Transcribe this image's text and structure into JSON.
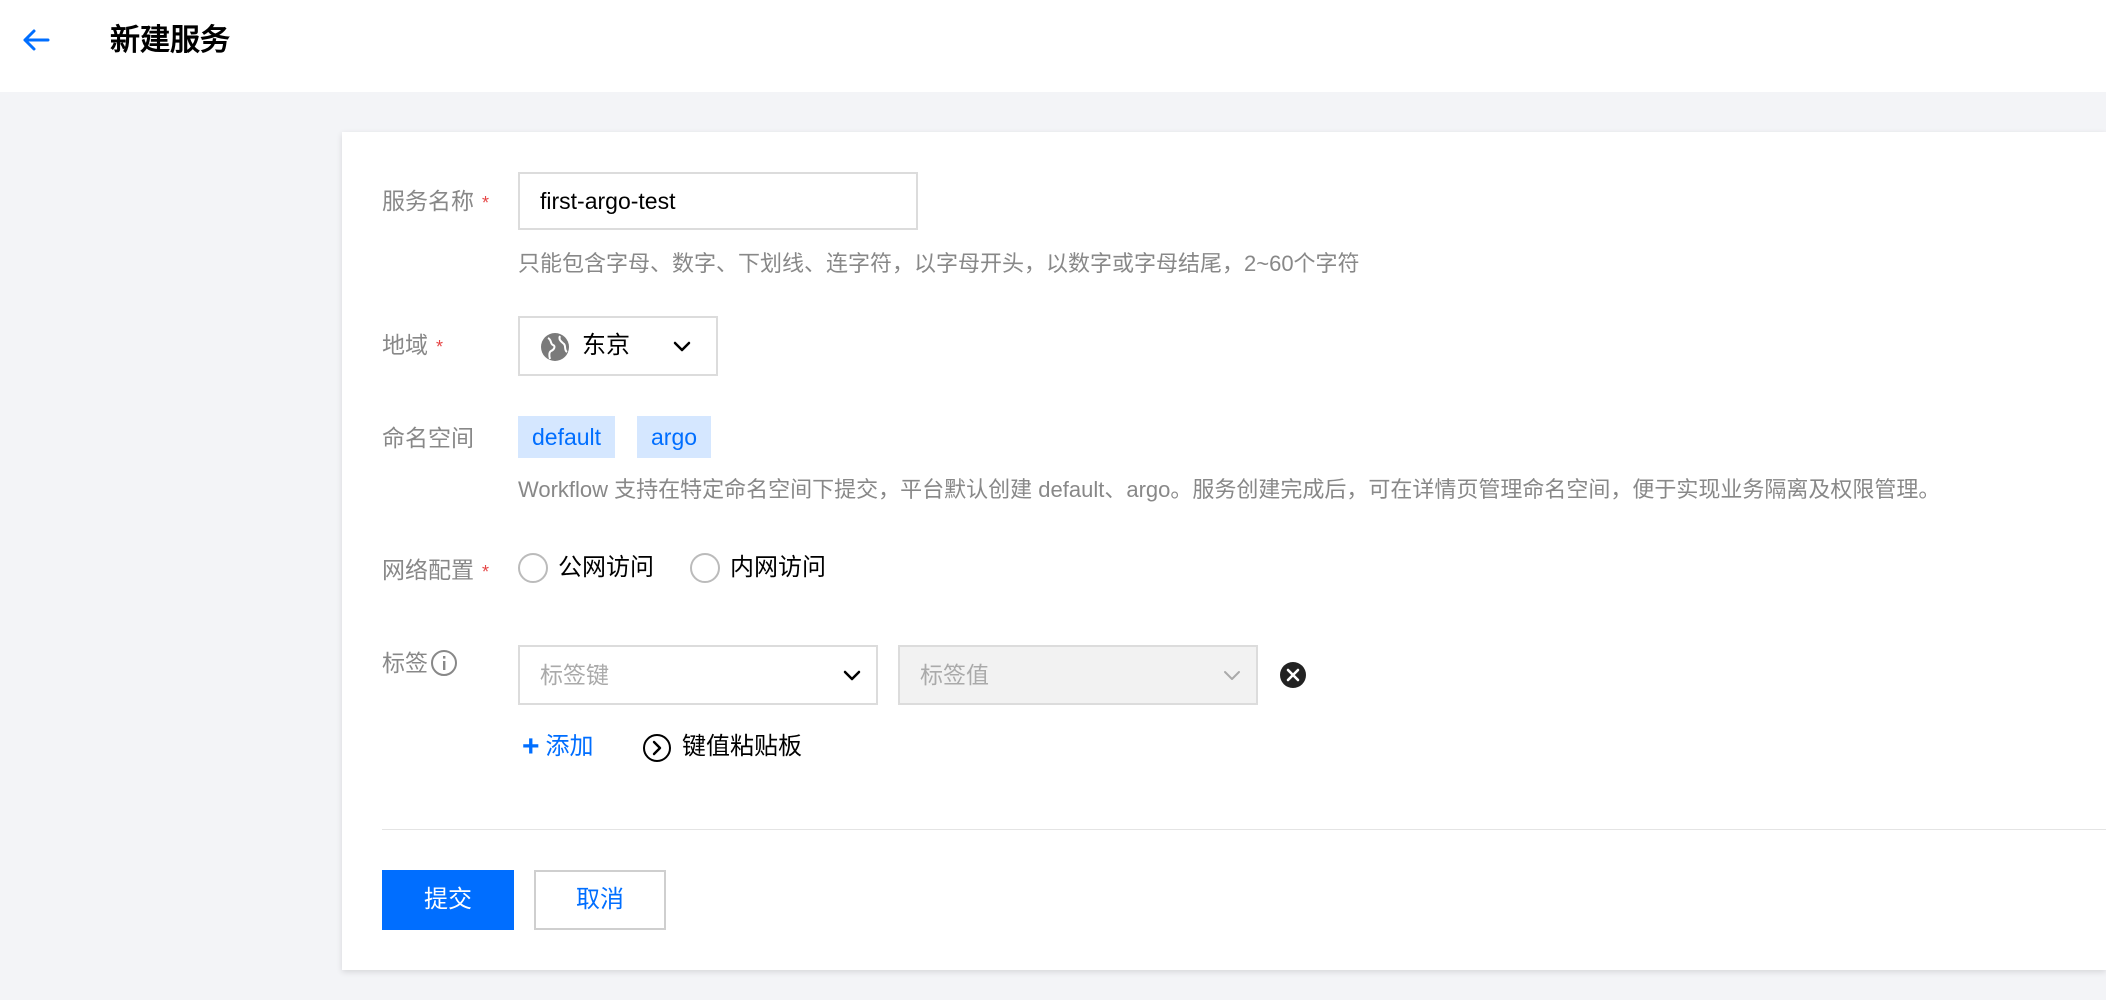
{
  "header": {
    "title": "新建服务"
  },
  "form": {
    "service_name": {
      "label": "服务名称",
      "required_mark": "*",
      "value": "first-argo-test",
      "hint": "只能包含字母、数字、下划线、连字符，以字母开头，以数字或字母结尾，2~60个字符"
    },
    "region": {
      "label": "地域",
      "required_mark": "*",
      "value": "东京",
      "icon": "globe-icon"
    },
    "namespace": {
      "label": "命名空间",
      "tags": [
        "default",
        "argo"
      ],
      "hint": "Workflow 支持在特定命名空间下提交，平台默认创建 default、argo。服务创建完成后，可在详情页管理命名空间，便于实现业务隔离及权限管理。"
    },
    "network": {
      "label": "网络配置",
      "required_mark": "*",
      "options": [
        "公网访问",
        "内网访问"
      ]
    },
    "tags": {
      "label": "标签",
      "key_placeholder": "标签键",
      "value_placeholder": "标签值",
      "add_label": "添加",
      "add_symbol": "+",
      "paste_label": "键值粘贴板"
    }
  },
  "actions": {
    "submit_label": "提交",
    "cancel_label": "取消"
  },
  "colors": {
    "primary": "#006eff",
    "required": "#e54545",
    "tag_bg": "#d5e7ff",
    "page_bg": "#f3f4f7"
  }
}
